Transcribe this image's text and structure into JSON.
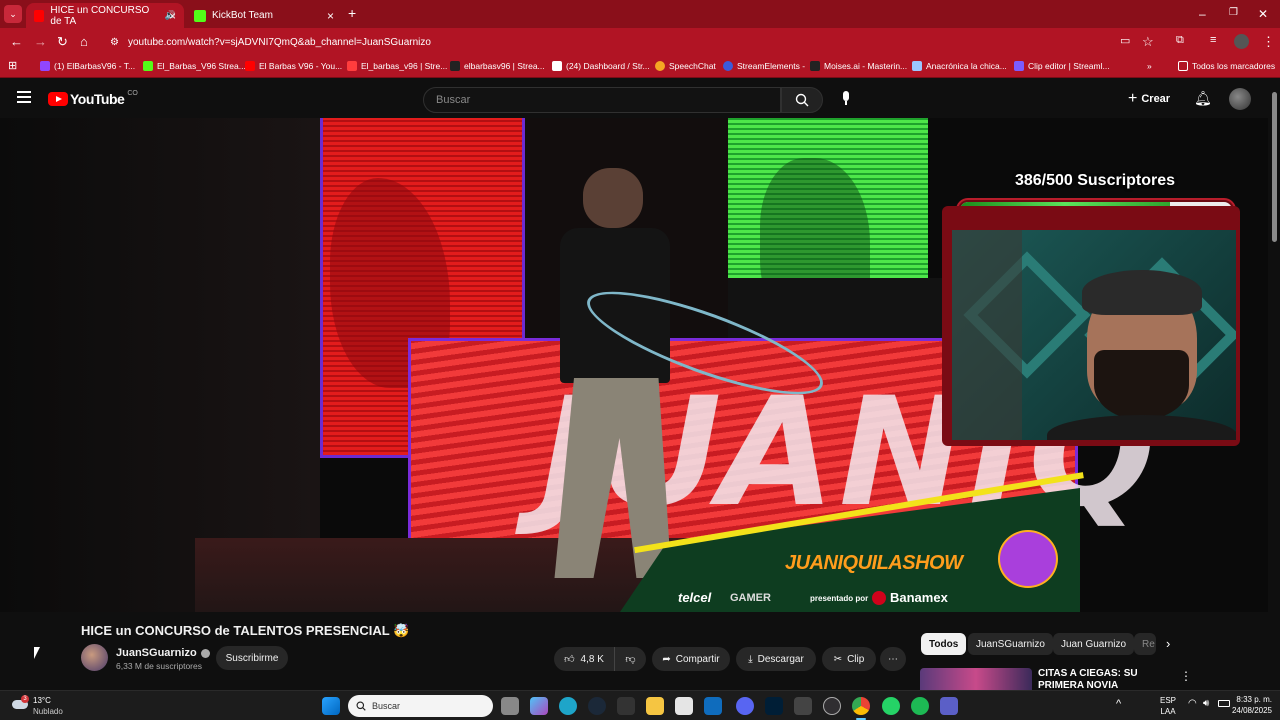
{
  "browser": {
    "tabs": [
      {
        "title": "HICE un CONCURSO de TA",
        "active": true
      },
      {
        "title": "KickBot Team",
        "active": false
      }
    ],
    "url": "youtube.com/watch?v=sjADVNI7QmQ&ab_channel=JuanSGuarnizo",
    "bookmarks": [
      "(1) ElBarbasV96 - T...",
      "El_Barbas_V96 Strea...",
      "El Barbas V96 - You...",
      "El_barbas_v96 | Stre...",
      "elbarbasv96 | Strea...",
      "(24) Dashboard / Str...",
      "SpeechChat",
      "StreamElements -",
      "Moises.ai - Masterin...",
      "Anacrónica la chica...",
      "Clip editor | Streaml..."
    ],
    "all_bookmarks": "Todos los marcadores"
  },
  "youtube": {
    "logo": "YouTube",
    "country": "CO",
    "search_placeholder": "Buscar",
    "create": "Crear"
  },
  "overlay": {
    "subs": "386/500 Suscriptores",
    "subs_fraction": 0.772,
    "banner": "JUANIQUILASHOW",
    "sponsor1": "telcel",
    "sponsor2": "GAMER",
    "presented": "presentado por",
    "banamex": "Banamex",
    "big_letters": "JUANIQ"
  },
  "video": {
    "title": "HICE un CONCURSO de TALENTOS PRESENCIAL 🤯",
    "channel": "JuanSGuarnizo",
    "subscribers": "6,33 M de suscriptores",
    "subscribe": "Suscribirme",
    "likes": "4,8 K",
    "share": "Compartir",
    "download": "Descargar",
    "clip": "Clip"
  },
  "chips": [
    "Todos",
    "JuanSGuarnizo",
    "Juan Guarnizo",
    "Re"
  ],
  "recommendation": {
    "title": "CITAS A CIEGAS: SU PRIMERA NOVIA"
  },
  "taskbar": {
    "temp": "13°C",
    "weather": "Nublado",
    "search": "Buscar",
    "lang1": "ESP",
    "lang2": "LAA",
    "time": "8:33 p. m.",
    "date": "24/08/2025",
    "weather_badge": "3"
  }
}
